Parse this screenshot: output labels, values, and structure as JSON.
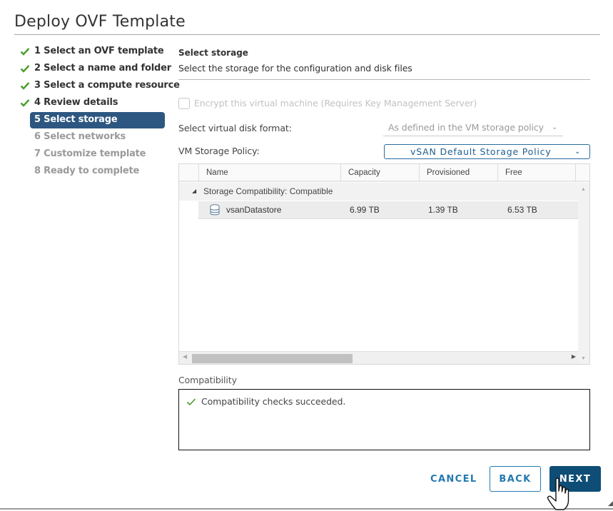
{
  "dialog": {
    "title": "Deploy OVF Template"
  },
  "steps": [
    {
      "label": "1 Select an OVF template",
      "state": "done"
    },
    {
      "label": "2 Select a name and folder",
      "state": "done"
    },
    {
      "label": "3 Select a compute resource",
      "state": "done"
    },
    {
      "label": "4 Review details",
      "state": "done"
    },
    {
      "label": "5 Select storage",
      "state": "active"
    },
    {
      "label": "6 Select networks",
      "state": "todo"
    },
    {
      "label": "7 Customize template",
      "state": "todo"
    },
    {
      "label": "8 Ready to complete",
      "state": "todo"
    }
  ],
  "section": {
    "title": "Select storage",
    "description": "Select the storage for the configuration and disk files"
  },
  "encrypt": {
    "label": "Encrypt this virtual machine (Requires Key Management Server)",
    "checked": false,
    "disabled": true
  },
  "disk_format": {
    "label": "Select virtual disk format:",
    "value": "As defined in the VM storage policy"
  },
  "storage_policy": {
    "label": "VM Storage Policy:",
    "value": "vSAN Default Storage Policy"
  },
  "grid": {
    "columns": [
      "Name",
      "Capacity",
      "Provisioned",
      "Free"
    ],
    "group_label": "Storage Compatibility: Compatible",
    "rows": [
      {
        "name": "vsanDatastore",
        "capacity": "6.99 TB",
        "provisioned": "1.39 TB",
        "free": "6.53 TB"
      }
    ]
  },
  "compatibility": {
    "label": "Compatibility",
    "message": "Compatibility checks succeeded."
  },
  "buttons": {
    "cancel": "CANCEL",
    "back": "BACK",
    "next": "NEXT"
  },
  "colors": {
    "accent": "#2379b0",
    "primary_button": "#0e4d76",
    "active_step": "#2d5780",
    "check_green": "#4a9d2a"
  }
}
